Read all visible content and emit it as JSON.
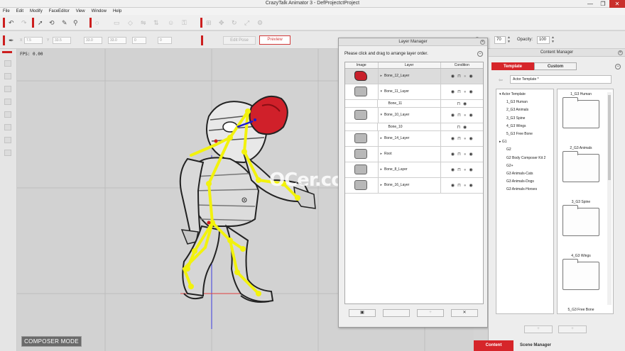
{
  "window": {
    "title": "CrazyTalk Animator 3  -  DefProjectctProject",
    "minimize": "—",
    "maximize": "❐",
    "close": "✕"
  },
  "menu": [
    "File",
    "Edit",
    "Modify",
    "FaceEditor",
    "View",
    "Window",
    "Help"
  ],
  "toolbar": {
    "edit_pose_label": "Edit Pose",
    "preview_label": "Preview",
    "fields": {
      "x_label": "X",
      "x_value": "7.5",
      "y_label": "Y",
      "y_value": "33.5",
      "w_value": "33.0",
      "h_value": "33.0",
      "r_value": "0",
      "s_value": "0"
    },
    "zoom_label": "Z",
    "zoom_value": "70",
    "opacity_label": "Opacity:",
    "opacity_value": "100"
  },
  "canvas": {
    "fps_text": "FPS: 0.00",
    "composer_mode_label": "COMPOSER MODE",
    "watermark": "OCer.com",
    "bone_color": "#f2f20d",
    "mask_color": "#d0202a"
  },
  "layer_manager": {
    "title": "Layer Manager",
    "instruction": "Please click and drag to arrange layer order.",
    "columns": {
      "image": "Image",
      "layer": "Layer",
      "condition": "Condition"
    },
    "rows": [
      {
        "name": "Bone_12_Layer",
        "arrow": "▸",
        "selected": true,
        "thumb": "red"
      },
      {
        "name": "Bone_11_Layer",
        "arrow": "▾",
        "selected": false,
        "thumb": "gray"
      },
      {
        "name": "Bone_11",
        "arrow": "",
        "selected": false,
        "thumb": "none",
        "child": true
      },
      {
        "name": "Bone_10_Layer",
        "arrow": "▾",
        "selected": false,
        "thumb": "gray"
      },
      {
        "name": "Bone_10",
        "arrow": "",
        "selected": false,
        "thumb": "none",
        "child": true
      },
      {
        "name": "Bone_14_Layer",
        "arrow": "▸",
        "selected": false,
        "thumb": "gray"
      },
      {
        "name": "Root",
        "arrow": "▸",
        "selected": false,
        "thumb": "gray"
      },
      {
        "name": "Bone_8_Layer",
        "arrow": "▸",
        "selected": false,
        "thumb": "gray"
      },
      {
        "name": "Bone_16_Layer",
        "arrow": "▸",
        "selected": false,
        "thumb": "gray"
      }
    ],
    "bottom_buttons": [
      "▣",
      "",
      "+",
      "✕"
    ]
  },
  "content_manager": {
    "title": "Content Manager",
    "tabs": [
      "Template",
      "Custom"
    ],
    "active_tab": "Template",
    "path_value": "Actor Template *",
    "tree": [
      {
        "label": "Actor Template",
        "prefix": "▾ ",
        "indent": 0
      },
      {
        "label": "1_G3 Human",
        "prefix": "",
        "indent": 1
      },
      {
        "label": "2_G3 Animals",
        "prefix": "",
        "indent": 1
      },
      {
        "label": "3_G3 Spine",
        "prefix": "",
        "indent": 1
      },
      {
        "label": "4_G3 Wings",
        "prefix": "",
        "indent": 1
      },
      {
        "label": "5_G3 Free Bone",
        "prefix": "",
        "indent": 1
      },
      {
        "label": "G1",
        "prefix": "▸ ",
        "indent": 0
      },
      {
        "label": "G2",
        "prefix": "",
        "indent": 1
      },
      {
        "label": "G2 Body Composer Kit 2",
        "prefix": "",
        "indent": 1
      },
      {
        "label": "G2+",
        "prefix": "",
        "indent": 1
      },
      {
        "label": "G3 Animals-Cats",
        "prefix": "",
        "indent": 1
      },
      {
        "label": "G3 Animals-Dogs",
        "prefix": "",
        "indent": 1
      },
      {
        "label": "G3 Animals-Horses",
        "prefix": "",
        "indent": 1
      }
    ],
    "items": [
      "1_G3 Human",
      "2_G3 Animals",
      "3_G3 Spine",
      "4_G3 Wings",
      "5_G3 Free Bone"
    ],
    "add_buttons": [
      "+",
      "+"
    ]
  },
  "dock_tabs": [
    "Content Manager",
    "Scene Manager"
  ],
  "active_dock_tab": "Content Manager",
  "accent_color": "#d6252a"
}
